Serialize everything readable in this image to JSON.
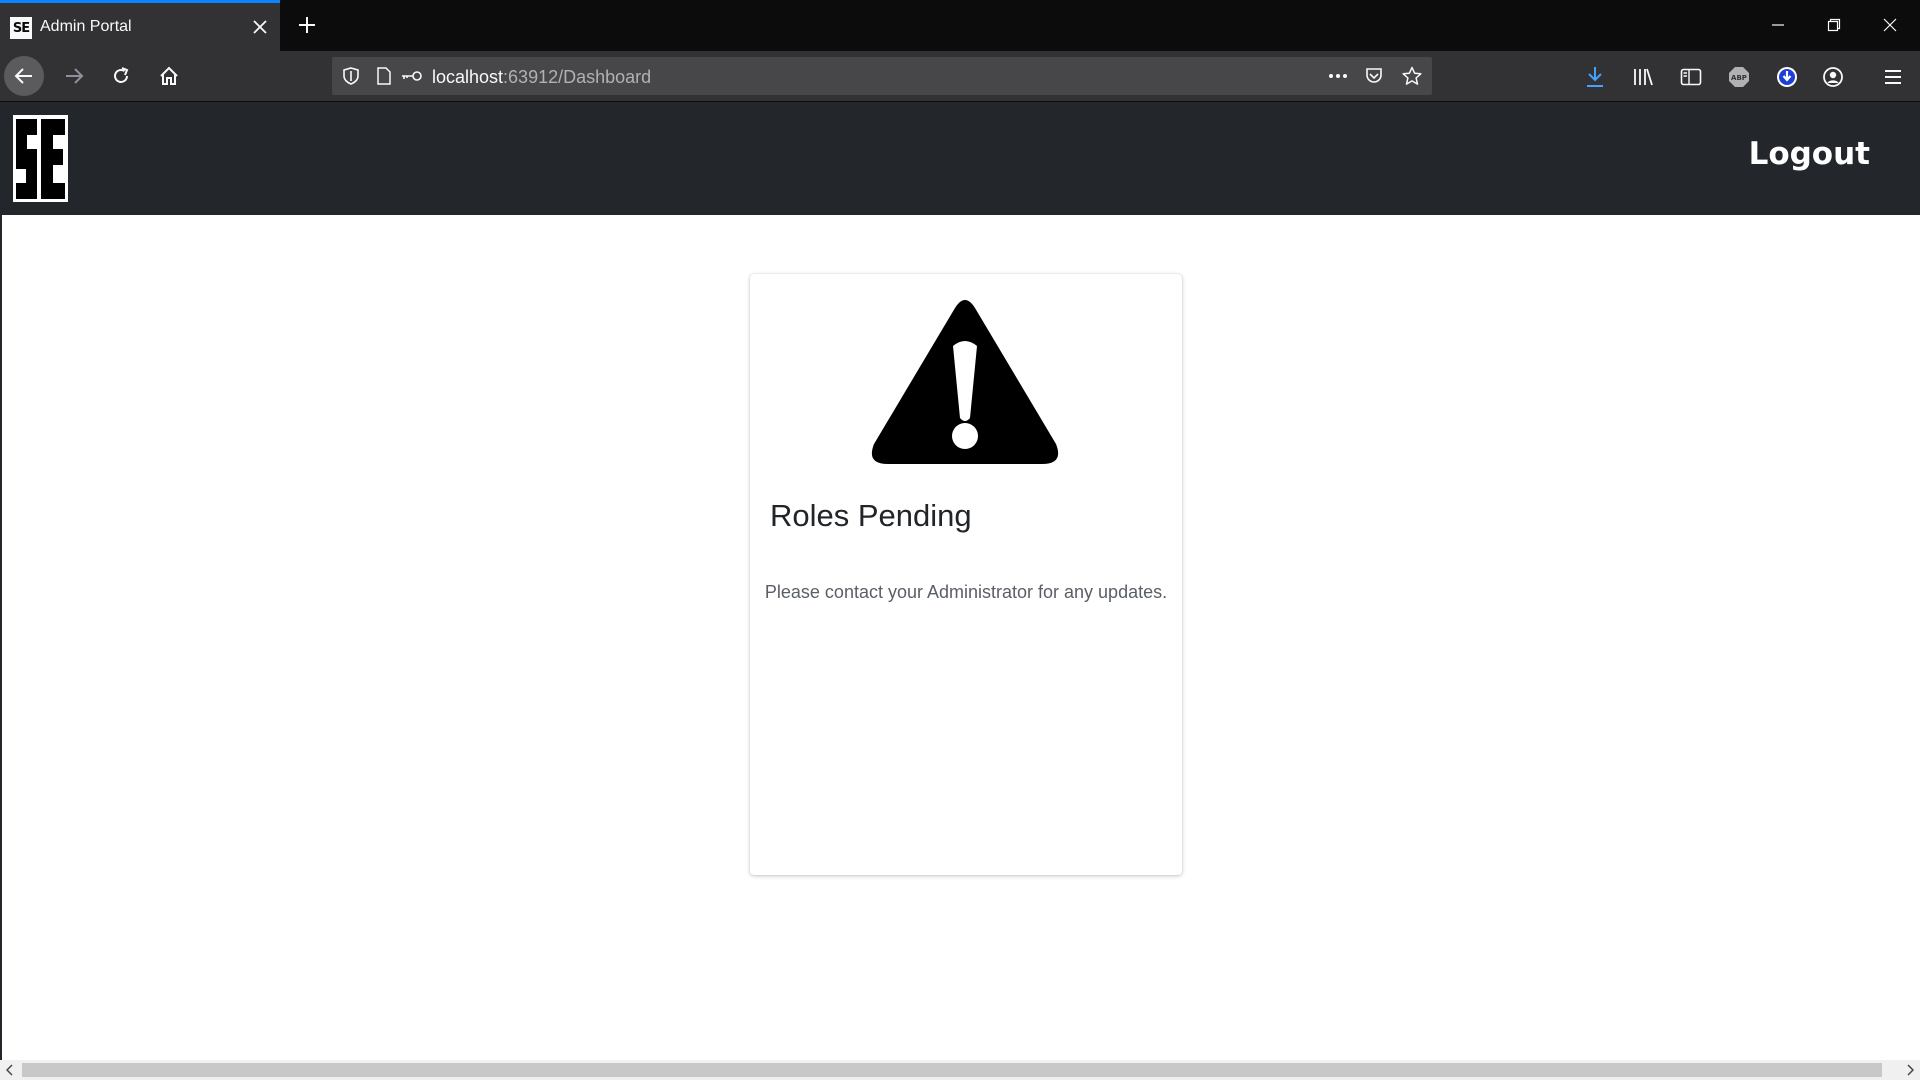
{
  "browser": {
    "tab": {
      "title": "Admin Portal",
      "favicon_text": "SE"
    },
    "url": {
      "host": "localhost",
      "rest": ":63912/Dashboard"
    },
    "toolbar_icons": [
      "download-icon",
      "library-icon",
      "sidebar-icon",
      "adblock-icon",
      "extension-icon",
      "account-icon",
      "menu-icon"
    ]
  },
  "header": {
    "logo_text": "SE",
    "logout_label": "Logout",
    "background": "#23272b"
  },
  "card": {
    "icon": "warning-icon",
    "title": "Roles Pending",
    "message": "Please contact your Administrator for any updates."
  },
  "colors": {
    "chrome_dark": "#0c0c0d",
    "chrome_toolbar": "#323234",
    "accent": "#0a84ff"
  }
}
